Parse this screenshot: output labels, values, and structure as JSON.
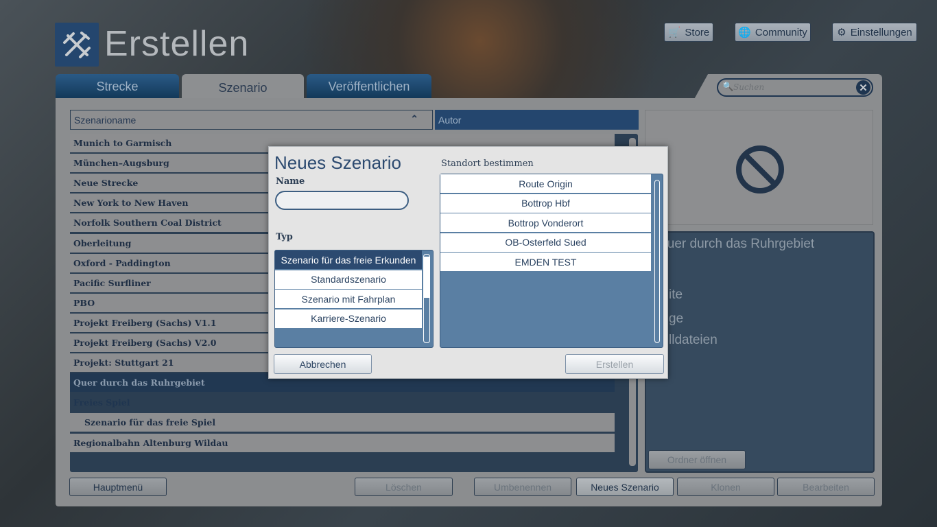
{
  "header": {
    "title": "Erstellen",
    "store": "Store",
    "community": "Community",
    "settings": "Einstellungen"
  },
  "tabs": [
    "Strecke",
    "Szenario",
    "Veröffentlichen"
  ],
  "search": {
    "placeholder": "Suchen"
  },
  "columns": {
    "name": "Szenarioname",
    "author": "Autor"
  },
  "rows": [
    {
      "label": "Munich to Garmisch",
      "kind": "normal"
    },
    {
      "label": "München–Augsburg",
      "kind": "normal"
    },
    {
      "label": "Neue Strecke",
      "kind": "normal"
    },
    {
      "label": "New York to New Haven",
      "kind": "normal"
    },
    {
      "label": "Norfolk Southern Coal District",
      "kind": "normal"
    },
    {
      "label": "Oberleitung",
      "kind": "normal"
    },
    {
      "label": "Oxford - Paddington",
      "kind": "normal"
    },
    {
      "label": "Pacific Surfliner",
      "kind": "normal"
    },
    {
      "label": "PBO",
      "kind": "normal"
    },
    {
      "label": "Projekt Freiberg (Sachs) V1.1",
      "kind": "normal"
    },
    {
      "label": "Projekt Freiberg (Sachs) V2.0",
      "kind": "normal"
    },
    {
      "label": "Projekt: Stuttgart 21",
      "kind": "normal"
    },
    {
      "label": "Quer durch das Ruhrgebiet",
      "kind": "sel"
    },
    {
      "label": "Freies Spiel",
      "kind": "grp"
    },
    {
      "label": "Szenario für das freie Spiel",
      "kind": "sub"
    },
    {
      "label": "Regionalbahn Altenburg Wildau",
      "kind": "normal"
    }
  ],
  "details": {
    "title": "Quer durch das Ruhrgebiet",
    "line1": "ite",
    "line2": "ge",
    "line3": "lldateien",
    "open_folder": "Ordner öffnen"
  },
  "bottom": {
    "main_menu": "Hauptmenü",
    "delete": "Löschen",
    "rename": "Umbenennen",
    "new": "Neues Szenario",
    "clone": "Klonen",
    "edit": "Bearbeiten"
  },
  "modal": {
    "title": "Neues Szenario",
    "name_label": "Name",
    "name_value": "",
    "type_label": "Typ",
    "types": [
      "Szenario für das freie Erkunden",
      "Standardszenario",
      "Szenario mit Fahrplan",
      "Karriere-Szenario"
    ],
    "location_label": "Standort bestimmen",
    "locations": [
      "Route Origin",
      "Bottrop Hbf",
      "Bottrop Vonderort",
      "OB-Osterfeld Sued",
      "EMDEN TEST"
    ],
    "cancel": "Abbrechen",
    "create": "Erstellen"
  },
  "colors": {
    "accent": "#2c4a70",
    "list_blue": "#5a7fa3"
  }
}
